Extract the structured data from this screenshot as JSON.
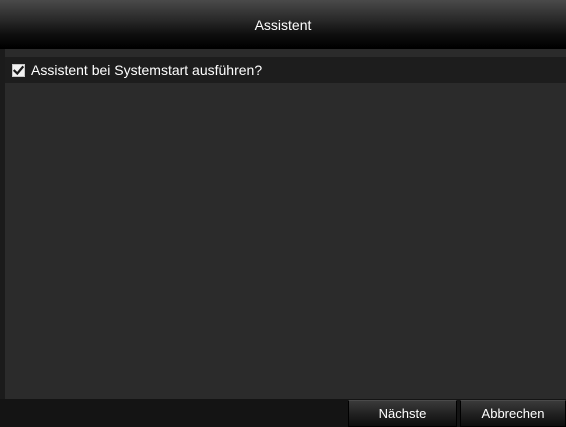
{
  "dialog": {
    "title": "Assistent",
    "option": {
      "label": "Assistent bei Systemstart ausführen?",
      "checked": true
    },
    "buttons": {
      "next": "Nächste",
      "cancel": "Abbrechen"
    }
  },
  "icons": {
    "checkbox": "checkmark-icon"
  }
}
